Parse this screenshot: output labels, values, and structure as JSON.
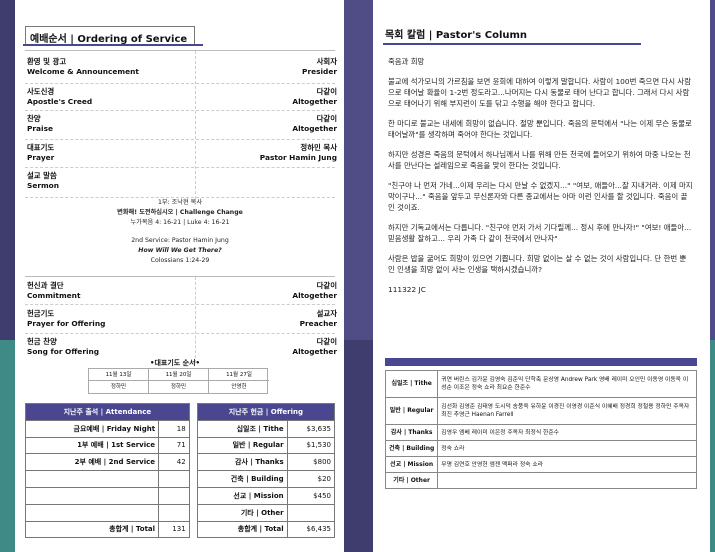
{
  "left": {
    "title": "예배순서 | Ordering of Service",
    "order": [
      {
        "ko": "환영 및 광고",
        "en": "Welcome & Announcement",
        "ko_r": "사회자",
        "en_r": "Presider"
      },
      {
        "ko": "사도신경",
        "en": "Apostle's Creed",
        "ko_r": "다같이",
        "en_r": "Altogether"
      },
      {
        "ko": "찬양",
        "en": "Praise",
        "ko_r": "다같이",
        "en_r": "Altogether"
      },
      {
        "ko": "대표기도",
        "en": "Prayer",
        "ko_r": "정하민 목사",
        "en_r": "Pastor Hamin Jung"
      },
      {
        "ko": "설교 말씀",
        "en": "Sermon",
        "ko_r": "",
        "en_r": ""
      }
    ],
    "sermon": {
      "l1": "1부: 조낙현 목사",
      "l2": "변화해! 도전하십시오 | Challenge Change",
      "l3": "누가복음 4: 16-21 | Luke 4: 16-21",
      "l4": "2nd Service: Pastor Hamin Jung",
      "l5": "How Will We Get There?",
      "l6": "Colossians 1:24-29"
    },
    "order2": [
      {
        "ko": "헌신과 결단",
        "en": "Commitment",
        "ko_r": "다같이",
        "en_r": "Altogether"
      },
      {
        "ko": "헌금기도",
        "en": "Prayer for Offering",
        "ko_r": "설교자",
        "en_r": "Preacher"
      },
      {
        "ko": "헌금 찬양",
        "en": "Song for Offering",
        "ko_r": "다같이",
        "en_r": "Altogether"
      }
    ],
    "prep_title": "•대표기도 순서•",
    "prep": {
      "d1": "11월 13일",
      "d2": "11월 20일",
      "d3": "11월 27일",
      "n1": "정하민",
      "n2": "정하민",
      "n3": "안영헌"
    },
    "stats": {
      "h1": "지난주 출석 | Attendance",
      "h2": "지난주 헌금 | Offering",
      "rows": [
        {
          "a": "금요예배 | Friday Night",
          "an": "18",
          "o": "십일조 | Tithe",
          "on": "$3,635"
        },
        {
          "a": "1부 예배 | 1st Service",
          "an": "71",
          "o": "일반 | Regular",
          "on": "$1,530"
        },
        {
          "a": "2부 예배 | 2nd Service",
          "an": "42",
          "o": "감사 | Thanks",
          "on": "$800"
        },
        {
          "a": "",
          "an": "",
          "o": "건축 | Building",
          "on": "$20"
        },
        {
          "a": "",
          "an": "",
          "o": "선교 | Mission",
          "on": "$450"
        },
        {
          "a": "",
          "an": "",
          "o": "기타 | Other",
          "on": ""
        },
        {
          "a": "총합계 | Total",
          "an": "131",
          "o": "총합계 | Total",
          "on": "$6,435"
        }
      ]
    }
  },
  "right": {
    "title": "목회 칼럼 | Pastor's Column",
    "p0": "죽음과 희망",
    "p1": "불교에 석가모니의 가르침을 보면 윤회에 대하여 이렇게 말합니다. 사람이 100번 죽으면 다시 사람으로 태어날 확율이 1-2번 정도라고...나머지는 다시 동물로 태어 난다고 합니다. 그래서 다시 사람으로 태어나기 위해 부지런이 도를 닦고 수행을 해야 한다고 합니다.",
    "p2": "한 마디로 불교는 내세에 희망이 없습니다. 절망 뿐입니다. 죽음의 문턱에서 \"나는 이제 무슨 동물로 태어날까\"를 생각하며 죽어야 한다는 것입니다.",
    "p3": "하지만 성경은 죽음의 문턱에서 하나님께서 나를 위해 만든 천국에 들어오기 위하여 마중 나오는 천사를 만난다는 설레임으로 죽음을 맞이 한다는 것입니다.",
    "p4": "\"친구야 나 먼저 가네...이제 우리는 다시 만날 수 없겠지...\" \"여보, 애들아...잘 지내거라. 이제 마지막이구나...\" 죽음을 앞두고 무신론자와 다른 종교에서는 아마 이런 인사를 할 것입니다. 죽음이 끝인 것이죠.",
    "p5": "하지만 기독교에서는 다릅니다. \"친구야 먼저 가서 기다릴께... 정시 후에 만나자!\" \"여보! 애들아... 믿음생활 잘하고... 우리 가족 다 같이 천국에서 만나자\"",
    "p6": "사람은 밥을 굶어도 희망이 있으면 기쁩니다. 희망 없이는 살 수 없는 것이 사람입니다. 단 한번 뿐인 인생을 희망 없이 사는 인생을 택하시겠습니까?",
    "sig": "111322 JC",
    "offering": [
      {
        "label": "십일조 | Tithe",
        "names": "귀연 버린스 김가윤 김영숙 김준익 단학축 문상영 Andrew Park 영배 레이미 오인민 이동영 이동욱 이성순 이조은 정숙 쇼라 최요순 한준수"
      },
      {
        "label": "일반 | Regular",
        "names": "김선화 김영준 김태영 도시덕 송풍욱 유하윤 이경진 이영경 이준식 이혜배 정경희 정철용 정하민 주옥자 최진 추영근 Haenan Farrell"
      },
      {
        "label": "감사 | Thanks",
        "names": "김영우 엠베 레이미 이은정 주옥자 최정식 한준수"
      },
      {
        "label": "건축 | Building",
        "names": "정숙 쇼라"
      },
      {
        "label": "선교 | Mission",
        "names": "무명 김연호 안영헌 엠젠 맥퍼라 정숙 쇼라"
      },
      {
        "label": "기타 | Other",
        "names": ""
      }
    ]
  },
  "colors": {
    "accent": "#4a4690",
    "teal": "#3f8a86",
    "navy": "#3e3d6e"
  }
}
